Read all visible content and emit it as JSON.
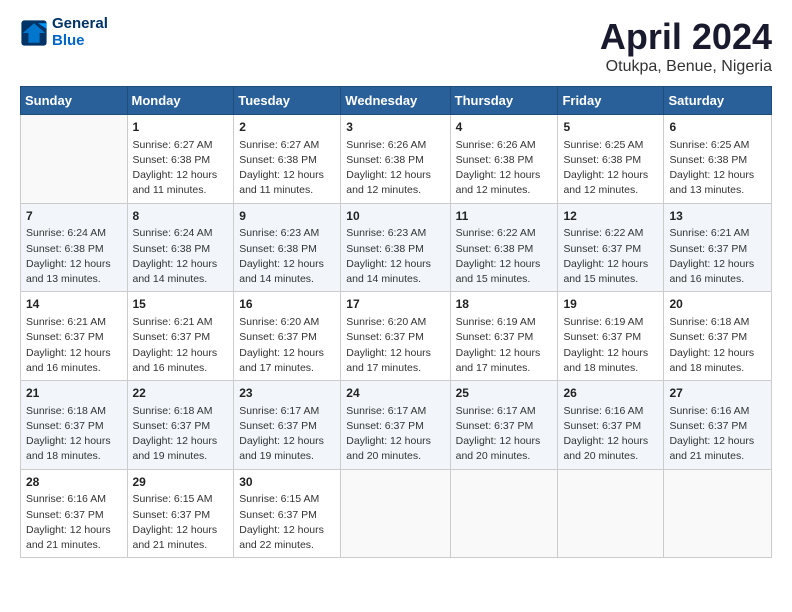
{
  "header": {
    "logo_line1": "General",
    "logo_line2": "Blue",
    "title": "April 2024",
    "subtitle": "Otukpa, Benue, Nigeria"
  },
  "weekdays": [
    "Sunday",
    "Monday",
    "Tuesday",
    "Wednesday",
    "Thursday",
    "Friday",
    "Saturday"
  ],
  "weeks": [
    [
      {
        "day": "",
        "info": ""
      },
      {
        "day": "1",
        "info": "Sunrise: 6:27 AM\nSunset: 6:38 PM\nDaylight: 12 hours\nand 11 minutes."
      },
      {
        "day": "2",
        "info": "Sunrise: 6:27 AM\nSunset: 6:38 PM\nDaylight: 12 hours\nand 11 minutes."
      },
      {
        "day": "3",
        "info": "Sunrise: 6:26 AM\nSunset: 6:38 PM\nDaylight: 12 hours\nand 12 minutes."
      },
      {
        "day": "4",
        "info": "Sunrise: 6:26 AM\nSunset: 6:38 PM\nDaylight: 12 hours\nand 12 minutes."
      },
      {
        "day": "5",
        "info": "Sunrise: 6:25 AM\nSunset: 6:38 PM\nDaylight: 12 hours\nand 12 minutes."
      },
      {
        "day": "6",
        "info": "Sunrise: 6:25 AM\nSunset: 6:38 PM\nDaylight: 12 hours\nand 13 minutes."
      }
    ],
    [
      {
        "day": "7",
        "info": "Sunrise: 6:24 AM\nSunset: 6:38 PM\nDaylight: 12 hours\nand 13 minutes."
      },
      {
        "day": "8",
        "info": "Sunrise: 6:24 AM\nSunset: 6:38 PM\nDaylight: 12 hours\nand 14 minutes."
      },
      {
        "day": "9",
        "info": "Sunrise: 6:23 AM\nSunset: 6:38 PM\nDaylight: 12 hours\nand 14 minutes."
      },
      {
        "day": "10",
        "info": "Sunrise: 6:23 AM\nSunset: 6:38 PM\nDaylight: 12 hours\nand 14 minutes."
      },
      {
        "day": "11",
        "info": "Sunrise: 6:22 AM\nSunset: 6:38 PM\nDaylight: 12 hours\nand 15 minutes."
      },
      {
        "day": "12",
        "info": "Sunrise: 6:22 AM\nSunset: 6:37 PM\nDaylight: 12 hours\nand 15 minutes."
      },
      {
        "day": "13",
        "info": "Sunrise: 6:21 AM\nSunset: 6:37 PM\nDaylight: 12 hours\nand 16 minutes."
      }
    ],
    [
      {
        "day": "14",
        "info": "Sunrise: 6:21 AM\nSunset: 6:37 PM\nDaylight: 12 hours\nand 16 minutes."
      },
      {
        "day": "15",
        "info": "Sunrise: 6:21 AM\nSunset: 6:37 PM\nDaylight: 12 hours\nand 16 minutes."
      },
      {
        "day": "16",
        "info": "Sunrise: 6:20 AM\nSunset: 6:37 PM\nDaylight: 12 hours\nand 17 minutes."
      },
      {
        "day": "17",
        "info": "Sunrise: 6:20 AM\nSunset: 6:37 PM\nDaylight: 12 hours\nand 17 minutes."
      },
      {
        "day": "18",
        "info": "Sunrise: 6:19 AM\nSunset: 6:37 PM\nDaylight: 12 hours\nand 17 minutes."
      },
      {
        "day": "19",
        "info": "Sunrise: 6:19 AM\nSunset: 6:37 PM\nDaylight: 12 hours\nand 18 minutes."
      },
      {
        "day": "20",
        "info": "Sunrise: 6:18 AM\nSunset: 6:37 PM\nDaylight: 12 hours\nand 18 minutes."
      }
    ],
    [
      {
        "day": "21",
        "info": "Sunrise: 6:18 AM\nSunset: 6:37 PM\nDaylight: 12 hours\nand 18 minutes."
      },
      {
        "day": "22",
        "info": "Sunrise: 6:18 AM\nSunset: 6:37 PM\nDaylight: 12 hours\nand 19 minutes."
      },
      {
        "day": "23",
        "info": "Sunrise: 6:17 AM\nSunset: 6:37 PM\nDaylight: 12 hours\nand 19 minutes."
      },
      {
        "day": "24",
        "info": "Sunrise: 6:17 AM\nSunset: 6:37 PM\nDaylight: 12 hours\nand 20 minutes."
      },
      {
        "day": "25",
        "info": "Sunrise: 6:17 AM\nSunset: 6:37 PM\nDaylight: 12 hours\nand 20 minutes."
      },
      {
        "day": "26",
        "info": "Sunrise: 6:16 AM\nSunset: 6:37 PM\nDaylight: 12 hours\nand 20 minutes."
      },
      {
        "day": "27",
        "info": "Sunrise: 6:16 AM\nSunset: 6:37 PM\nDaylight: 12 hours\nand 21 minutes."
      }
    ],
    [
      {
        "day": "28",
        "info": "Sunrise: 6:16 AM\nSunset: 6:37 PM\nDaylight: 12 hours\nand 21 minutes."
      },
      {
        "day": "29",
        "info": "Sunrise: 6:15 AM\nSunset: 6:37 PM\nDaylight: 12 hours\nand 21 minutes."
      },
      {
        "day": "30",
        "info": "Sunrise: 6:15 AM\nSunset: 6:37 PM\nDaylight: 12 hours\nand 22 minutes."
      },
      {
        "day": "",
        "info": ""
      },
      {
        "day": "",
        "info": ""
      },
      {
        "day": "",
        "info": ""
      },
      {
        "day": "",
        "info": ""
      }
    ]
  ]
}
